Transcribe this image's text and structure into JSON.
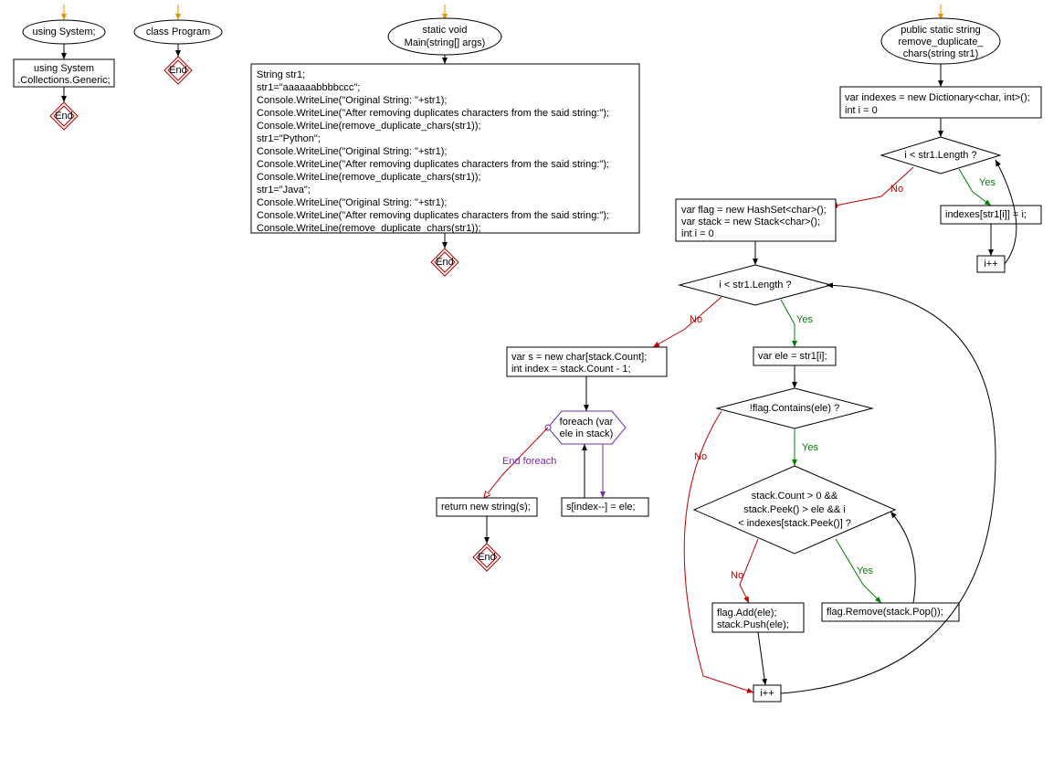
{
  "nodes": {
    "usingSystem": "using System;",
    "collGeneric1": "using System",
    "collGeneric2": ".Collections.Generic;",
    "classProgram": "class Program",
    "mainHeader1": "static void",
    "mainHeader2": "Main(string[] args)",
    "mainBody": [
      "String str1;",
      "str1=\"aaaaaabbbbccc\";",
      "Console.WriteLine(\"Original String: \"+str1);",
      "Console.WriteLine(\"After removing duplicates characters from the said string:\");",
      "Console.WriteLine(remove_duplicate_chars(str1));",
      "str1=\"Python\";",
      "Console.WriteLine(\"Original String: \"+str1);",
      "Console.WriteLine(\"After removing duplicates characters from the said string:\");",
      "Console.WriteLine(remove_duplicate_chars(str1));",
      "str1=\"Java\";",
      "Console.WriteLine(\"Original String: \"+str1);",
      "Console.WriteLine(\"After removing duplicates characters from the said string:\");",
      "Console.WriteLine(remove_duplicate_chars(str1));"
    ],
    "funcHeader1": "public static string",
    "funcHeader2": "remove_duplicate_",
    "funcHeader3": "chars(string str1)",
    "initIndexes1": "var indexes = new Dictionary<char, int>();",
    "initIndexes2": "int i = 0",
    "loop1Cond": "i < str1.Length ?",
    "indexAssign": "indexes[str1[i]] = i;",
    "iInc1": "i++",
    "initStack1": "var flag = new HashSet<char>();",
    "initStack2": "var stack = new Stack<char>();",
    "initStack3": "int i = 0",
    "loop2Cond": "i < str1.Length ?",
    "eleAssign": "var ele = str1[i];",
    "flagCond": "!flag.Contains(ele) ?",
    "stackCond1": "stack.Count > 0 &&",
    "stackCond2": "stack.Peek() > ele && i",
    "stackCond3": "< indexes[stack.Peek()] ?",
    "flagRemove": "flag.Remove(stack.Pop());",
    "flagAdd1": "flag.Add(ele);",
    "flagAdd2": "stack.Push(ele);",
    "iInc2": "i++",
    "sInit1": "var s = new char[stack.Count];",
    "sInit2": "int index = stack.Count - 1;",
    "foreach1": "foreach (var",
    "foreach2": "ele in stack)",
    "sIndex": "s[index--] = ele;",
    "returnS": "return new string(s);",
    "end": "End",
    "endForeach": "End foreach"
  },
  "labels": {
    "yes": "Yes",
    "no": "No"
  }
}
